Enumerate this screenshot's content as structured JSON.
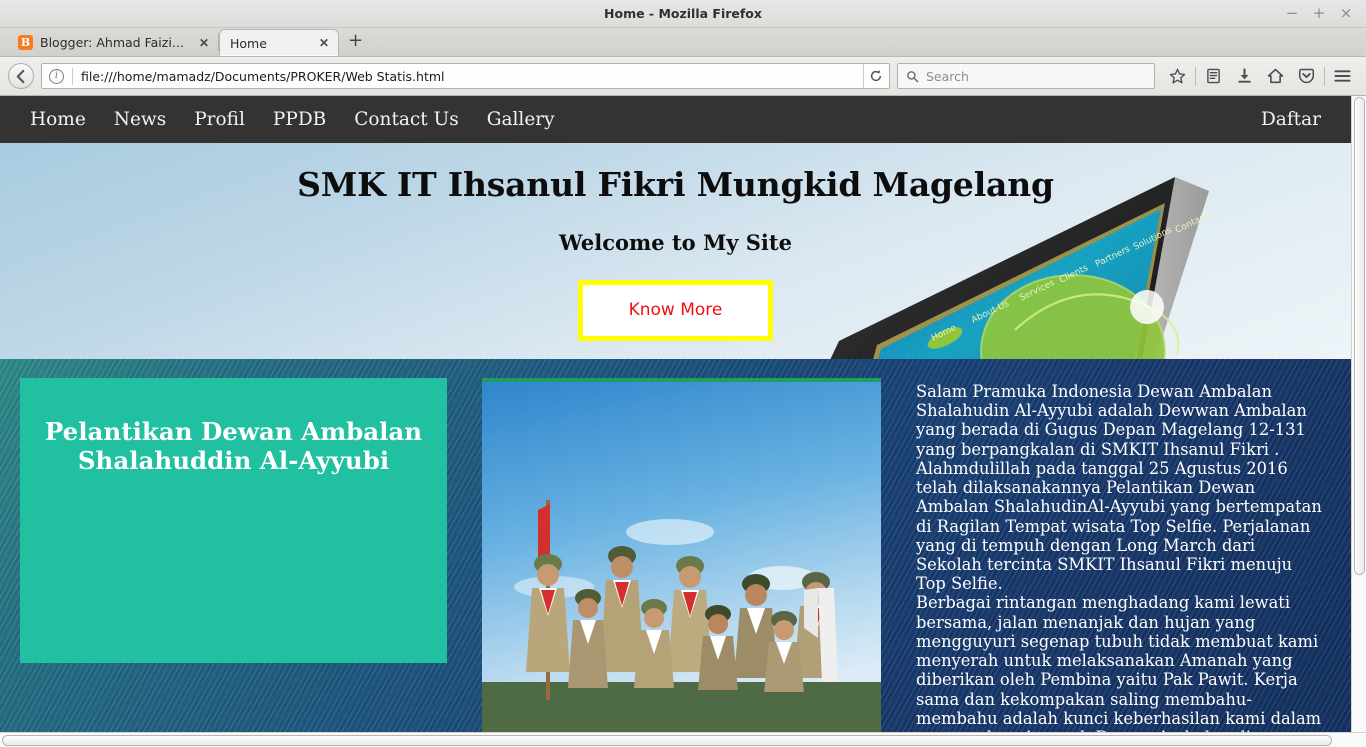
{
  "window": {
    "title": "Home - Mozilla Firefox",
    "minimize_label": "−",
    "maximize_label": "+",
    "close_label": "×"
  },
  "tabs": [
    {
      "label": "Blogger: Ahmad Faizin | ...",
      "favicon": "blogger-icon",
      "favicon_glyph": "B",
      "close_label": "✕",
      "active": false
    },
    {
      "label": "Home",
      "favicon": "none",
      "favicon_glyph": "",
      "close_label": "✕",
      "active": true
    }
  ],
  "new_tab_label": "+",
  "toolbar": {
    "back_label": "←",
    "info_label": "i",
    "url": "file:///home/mamadz/Documents/PROKER/Web Statis.html",
    "reload_label": "↻",
    "search_placeholder": "Search",
    "search_value": "",
    "icons": [
      {
        "name": "bookmark-star-icon",
        "glyph": "☆"
      },
      {
        "name": "library-icon",
        "glyph": "☰"
      },
      {
        "name": "downloads-icon",
        "glyph": "↓"
      },
      {
        "name": "home-icon",
        "glyph": "⌂"
      },
      {
        "name": "pocket-icon",
        "glyph": "▼"
      },
      {
        "name": "menu-hamburger-icon",
        "glyph": "☰"
      }
    ]
  },
  "site": {
    "nav": [
      {
        "label": "Home"
      },
      {
        "label": "News"
      },
      {
        "label": "Profil"
      },
      {
        "label": "PPDB"
      },
      {
        "label": "Contact Us"
      },
      {
        "label": "Gallery"
      }
    ],
    "nav_right": {
      "label": "Daftar"
    },
    "hero": {
      "title": "SMK IT Ihsanul Fikri Mungkid Magelang",
      "subtitle": "Welcome to My Site",
      "cta_label": "Know More",
      "cta_border_color": "#ffff00",
      "cta_text_color": "#ee1111",
      "monitor_nav": [
        "Home",
        "About Us",
        "Services",
        "Clients",
        "Partners",
        "Solutions",
        "Contacts"
      ]
    },
    "content": {
      "card_title": "Pelantikan Dewan Ambalan Shalahuddin Al-Ayyubi",
      "card_color": "#20c0a0",
      "photo_alt": "scout-group-photo",
      "article": [
        "Salam Pramuka Indonesia Dewan Ambalan Shalahudin Al-Ayyubi adalah Dewwan Ambalan yang berada di Gugus Depan Magelang 12-131 yang berpangkalan di SMKIT Ihsanul Fikri . Alahmdulillah pada tanggal 25 Agustus 2016 telah dilaksanakannya Pelantikan Dewan Ambalan ShalahudinAl-Ayyubi yang bertempatan di Ragilan Tempat wisata Top Selfie. Perjalanan yang di tempuh dengan Long March dari Sekolah tercinta SMKIT Ihsanul Fikri menuju Top Selfie.",
        "Berbagai rintangan menghadang kami lewati bersama, jalan menanjak dan hujan yang mengguyuri segenap tubuh tidak membuat kami menyerah untuk melaksanakan Amanah yang diberikan oleh Pembina yaitu Pak Pawit. Kerja sama dan kekompakan saling membahu-membahu adalah kunci keberhasilan kami dalam mengemban Amanah Dewan Ambalan di"
      ]
    }
  }
}
